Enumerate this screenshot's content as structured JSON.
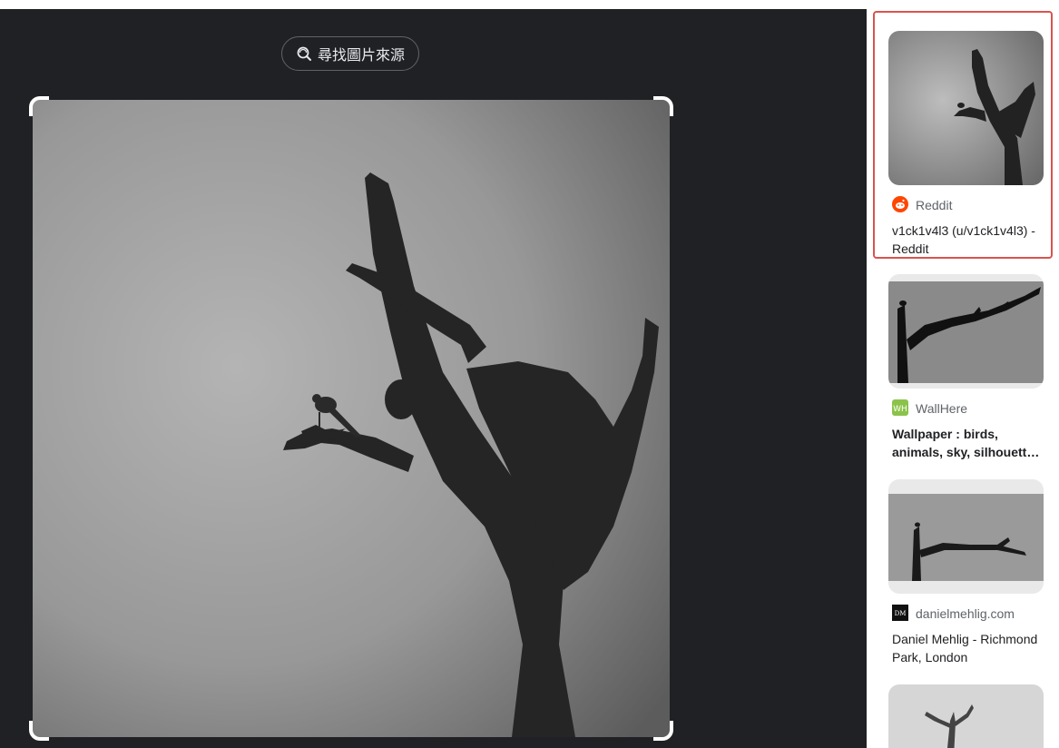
{
  "viewer": {
    "find_source_label": "尋找圖片來源"
  },
  "results": [
    {
      "source": "Reddit",
      "title": "v1ck1v4l3 (u/v1ck1v4l3) - Reddit",
      "favicon": "reddit-icon"
    },
    {
      "source": "WallHere",
      "title": "Wallpaper : birds, animals, sky, silhouett…",
      "favicon": "wallhere-icon"
    },
    {
      "source": "danielmehlig.com",
      "title": "Daniel Mehlig - Richmond Park, London",
      "favicon": "dm-icon"
    }
  ],
  "colors": {
    "viewer_bg": "#202124",
    "highlight": "#d9534f",
    "reddit": "#ff4500",
    "wallhere": "#8bc34a"
  }
}
